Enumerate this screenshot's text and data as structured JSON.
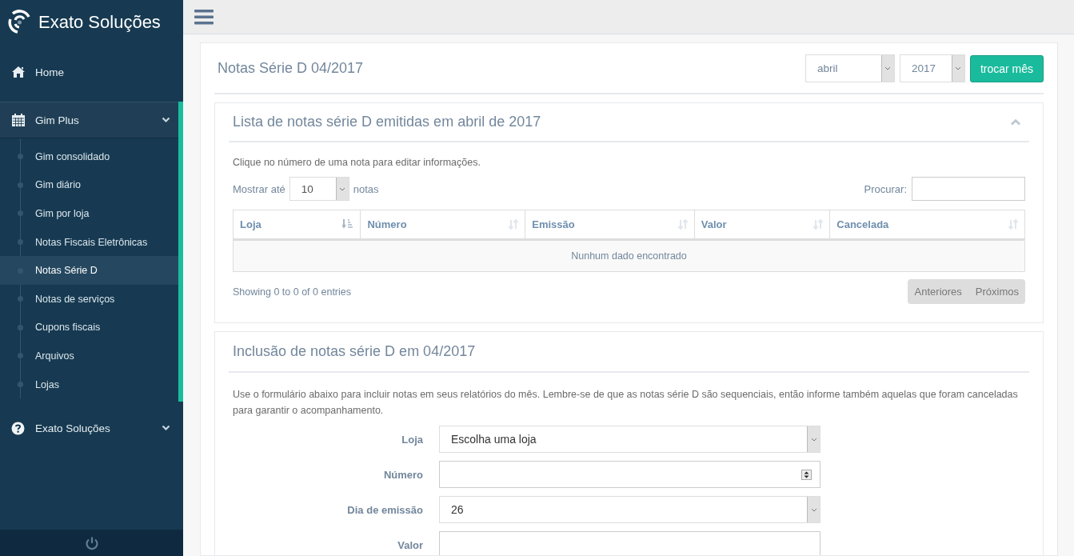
{
  "brand": {
    "name": "Exato Soluções"
  },
  "sidebar": {
    "items": [
      {
        "label": "Home",
        "kind": "link"
      },
      {
        "label": "Gim Plus",
        "kind": "group",
        "expanded": true,
        "children": [
          {
            "label": "Gim consolidado",
            "selected": false
          },
          {
            "label": "Gim diário",
            "selected": false
          },
          {
            "label": "Gim por loja",
            "selected": false
          },
          {
            "label": "Notas Fiscais Eletrônicas",
            "selected": false
          },
          {
            "label": "Notas Série D",
            "selected": true
          },
          {
            "label": "Notas de serviços",
            "selected": false
          },
          {
            "label": "Cupons fiscais",
            "selected": false
          },
          {
            "label": "Arquivos",
            "selected": false
          },
          {
            "label": "Lojas",
            "selected": false
          }
        ]
      },
      {
        "label": "Exato Soluções",
        "kind": "group",
        "expanded": false
      }
    ]
  },
  "page": {
    "title": "Notas Série D 04/2017",
    "month_select": "abril",
    "year_select": "2017",
    "button": "trocar mês"
  },
  "list_panel": {
    "title": "Lista de notas série D emitidas em abril de 2017",
    "expanded": true,
    "hint": "Clique no número de uma nota para editar informações.",
    "length": {
      "before": "Mostrar até",
      "value": "10",
      "after": "notas"
    },
    "search": {
      "label": "Procurar:"
    },
    "table": {
      "columns": [
        {
          "label": "Loja",
          "sorted": true
        },
        {
          "label": "Número",
          "sorted": false
        },
        {
          "label": "Emissão",
          "sorted": false
        },
        {
          "label": "Valor",
          "sorted": false
        },
        {
          "label": "Cancelada",
          "sorted": false
        }
      ],
      "empty_message": "Nunhum dado encontrado"
    },
    "info": "Showing 0 to 0 of 0 entries",
    "pagination": [
      "Anteriores",
      "Próximos"
    ]
  },
  "form_panel": {
    "title": "Inclusão de notas série D em 04/2017",
    "description": "Use o formulário abaixo para incluir notas em seus relatórios do mês. Lembre-se de que as notas série D são sequenciais, então informe também aquelas que foram canceladas para garantir o acompanhamento.",
    "fields": [
      {
        "label": "Loja",
        "kind": "select",
        "value": "Escolha uma loja"
      },
      {
        "label": "Número",
        "kind": "number"
      },
      {
        "label": "Dia de emissão",
        "kind": "select",
        "value": "26"
      },
      {
        "label": "Valor",
        "kind": "text"
      }
    ]
  }
}
